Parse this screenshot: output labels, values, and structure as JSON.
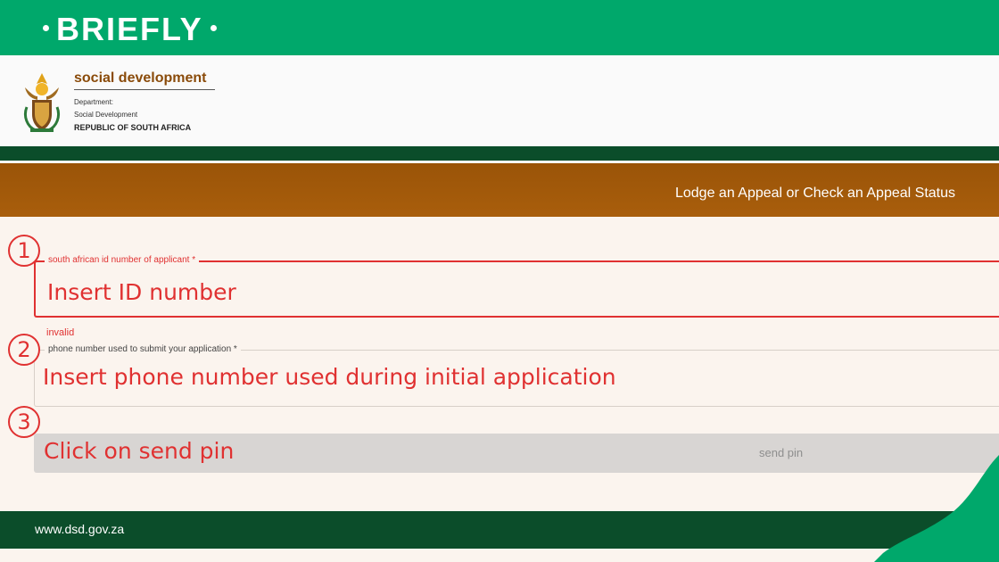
{
  "brand": {
    "name": "BRIEFLY",
    "color": "#00a86b"
  },
  "header": {
    "org_name": "social development",
    "department": "Department:",
    "sub_department": "Social Development",
    "country": "REPUBLIC OF SOUTH AFRICA"
  },
  "banner": {
    "title": "Lodge an Appeal or Check an Appeal Status"
  },
  "form": {
    "id_field": {
      "step": "1",
      "label": "south african id number of applicant *",
      "annotation": "Insert ID number",
      "error": "invalid"
    },
    "phone_field": {
      "step": "2",
      "label": "phone number used to submit your application *",
      "annotation": "Insert phone number used during initial application"
    },
    "send_pin": {
      "step": "3",
      "annotation": "Click on send pin",
      "label": "send pin"
    }
  },
  "footer": {
    "url": "www.dsd.gov.za"
  },
  "colors": {
    "annotation_red": "#e03131",
    "dsd_green": "#0b4d2a",
    "dsd_brown": "#9a5408"
  }
}
